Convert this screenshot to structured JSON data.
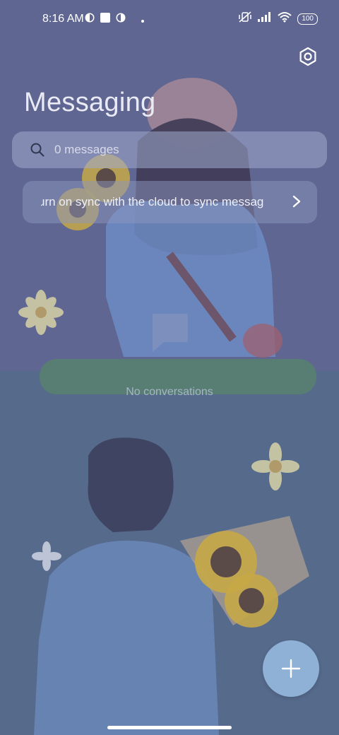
{
  "status_bar": {
    "time": "8:16 AM",
    "battery": "100"
  },
  "header": {
    "title": "Messaging",
    "settings_icon": "gear-icon"
  },
  "search": {
    "placeholder": "0 messages",
    "icon": "search-icon"
  },
  "sync_banner": {
    "text": "urn on sync with the cloud to sync messag",
    "icon": "chevron-right-icon"
  },
  "empty_state": {
    "text": "No conversations",
    "icon": "message-bubble-icon"
  },
  "fab": {
    "icon": "plus-icon"
  },
  "colors": {
    "background_top": "#5f6691",
    "background_bottom": "#566a8c",
    "fab": "#8fb1d6",
    "empty_bar": "#587e73"
  }
}
